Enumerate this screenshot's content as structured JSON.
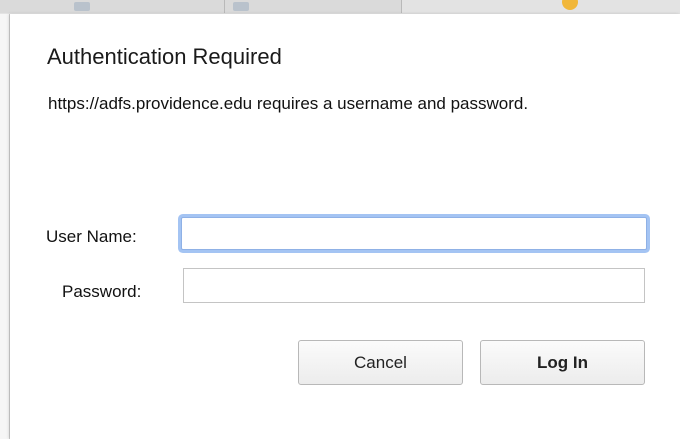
{
  "dialog": {
    "title": "Authentication Required",
    "message": "https://adfs.providence.edu requires a username and password."
  },
  "fields": {
    "username": {
      "label": "User Name:",
      "value": "",
      "placeholder": ""
    },
    "password": {
      "label": "Password:",
      "value": "",
      "placeholder": ""
    }
  },
  "buttons": {
    "cancel": "Cancel",
    "login": "Log In"
  },
  "colors": {
    "focus_ring": "#a4c4f3",
    "dialog_background": "#ffffff",
    "chrome_accent": "#f1b73a"
  }
}
